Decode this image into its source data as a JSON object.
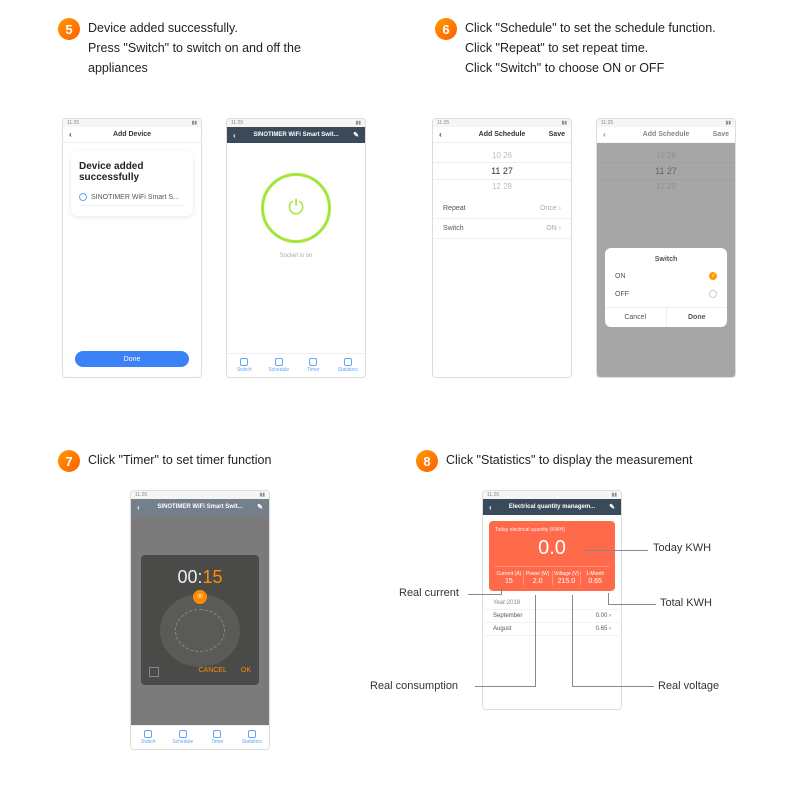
{
  "step5": {
    "num": "5",
    "lines": [
      "Device added successfully.",
      "Press \"Switch\" to switch on and off the",
      "appliances"
    ],
    "phone1": {
      "status_time": "11:25",
      "title": "Add Device",
      "heading": "Device added\nsuccessfully",
      "device": "SINOTIMER WiFi Smart S...",
      "done": "Done"
    },
    "phone2": {
      "status_time": "11:25",
      "title": "SINOTIMER WiFi Smart Swit...",
      "status": "Socket is on",
      "tabs": [
        "Switch",
        "Schedule",
        "Timer",
        "Statistics"
      ]
    }
  },
  "step6": {
    "num": "6",
    "lines": [
      "Click \"Schedule\" to set the schedule function.",
      "Click \"Repeat\" to set repeat time.",
      "Click \"Switch\" to choose ON or OFF"
    ],
    "phone1": {
      "title": "Add Schedule",
      "save": "Save",
      "picker": [
        "10  26",
        "11  27",
        "12  28"
      ],
      "repeat_label": "Repeat",
      "repeat_value": "Once",
      "switch_label": "Switch",
      "switch_value": "ON"
    },
    "phone2": {
      "title": "Add Schedule",
      "save": "Save",
      "sheet_title": "Switch",
      "opt_on": "ON",
      "opt_off": "OFF",
      "cancel": "Cancel",
      "done": "Done"
    }
  },
  "step7": {
    "num": "7",
    "text": "Click \"Timer\" to set timer function",
    "phone": {
      "title": "SINOTIMER WiFi Smart Swit...",
      "time_h": "00",
      "time_sep": ":",
      "time_m": "15",
      "knob": "00",
      "cancel": "CANCEL",
      "ok": "OK",
      "tabs": [
        "Switch",
        "Schedule",
        "Timer",
        "Statistics"
      ]
    }
  },
  "step8": {
    "num": "8",
    "text": "Click \"Statistics\" to display the measurement",
    "phone": {
      "title": "Electrical quantity managem...",
      "card_title": "Today electrical quantity (KWH)",
      "big_value": "0.0",
      "cols": [
        {
          "label": "Current (A)",
          "value": "15"
        },
        {
          "label": "Power (W)",
          "value": "2.0"
        },
        {
          "label": "Voltage (V)",
          "value": "215.0"
        },
        {
          "label": "1-Month",
          "value": "0.65"
        }
      ],
      "year_label": "Year:2019",
      "months": [
        {
          "name": "September",
          "value": "0.00"
        },
        {
          "name": "August",
          "value": "0.65"
        }
      ]
    },
    "annotations": {
      "today_kwh": "Today KWH",
      "real_current": "Real current",
      "total_kwh": "Total KWH",
      "real_consumption": "Real consumption",
      "real_voltage": "Real voltage"
    }
  }
}
